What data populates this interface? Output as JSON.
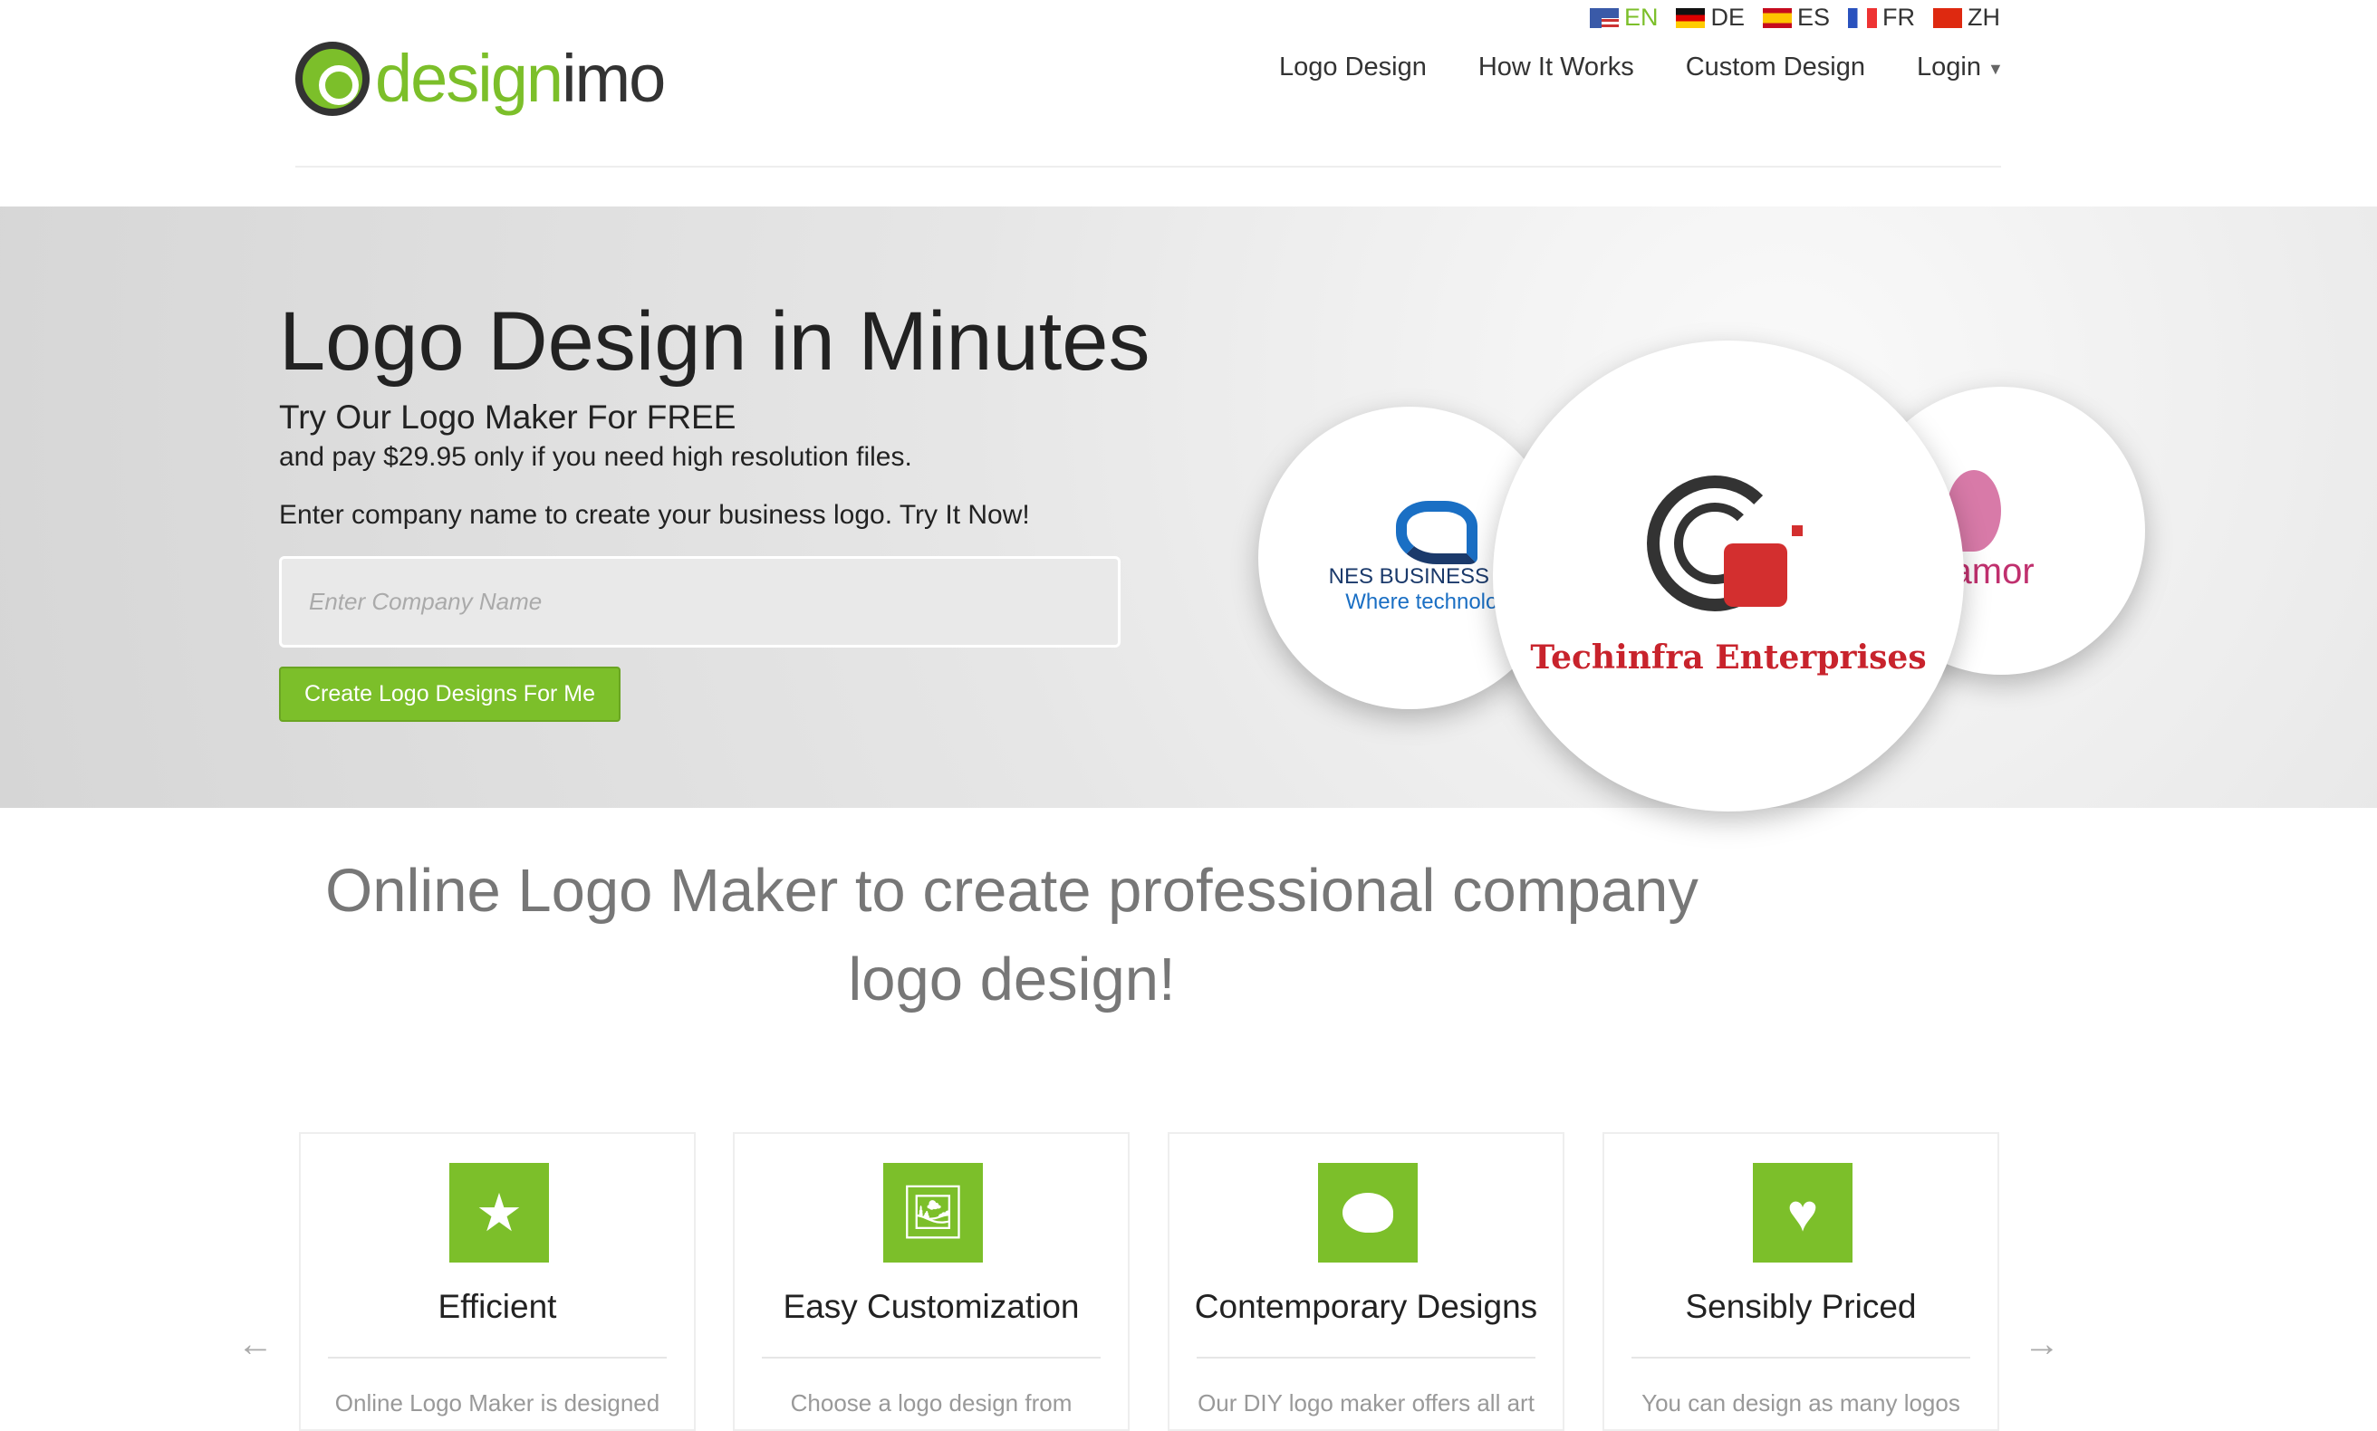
{
  "brand": {
    "prefix": "design",
    "suffix": "imo",
    "accent": "#7cbf2a"
  },
  "languages": [
    {
      "code": "EN",
      "active": true
    },
    {
      "code": "DE"
    },
    {
      "code": "ES"
    },
    {
      "code": "FR"
    },
    {
      "code": "ZH"
    }
  ],
  "nav": [
    "Logo Design",
    "How It Works",
    "Custom Design",
    "Login"
  ],
  "hero": {
    "title": "Logo Design in Minutes",
    "subtitle": "Try Our Logo Maker For FREE",
    "pay": "and pay $29.95 only if you need high resolution files.",
    "prompt": "Enter company name to create your business logo. Try It Now!",
    "placeholder": "Enter Company Name",
    "cta": "Create Logo Designs For Me",
    "samples": {
      "left_line1": "NES BUSINESS SO",
      "left_line2": "Where technolog",
      "center": "Techinfra Enterprises",
      "right": "namor"
    }
  },
  "section_heading": "Online Logo Maker to create professional company logo design!",
  "cards": [
    {
      "icon": "star-icon",
      "title": "Efficient",
      "desc": "Online Logo Maker is designed"
    },
    {
      "icon": "image-edit-icon",
      "title": "Easy Customization",
      "desc": "Choose a logo design from"
    },
    {
      "icon": "palette-icon",
      "title": "Contemporary Designs",
      "desc": "Our DIY logo maker offers all art"
    },
    {
      "icon": "heart-icon",
      "title": "Sensibly Priced",
      "desc": "You can design as many logos"
    }
  ]
}
